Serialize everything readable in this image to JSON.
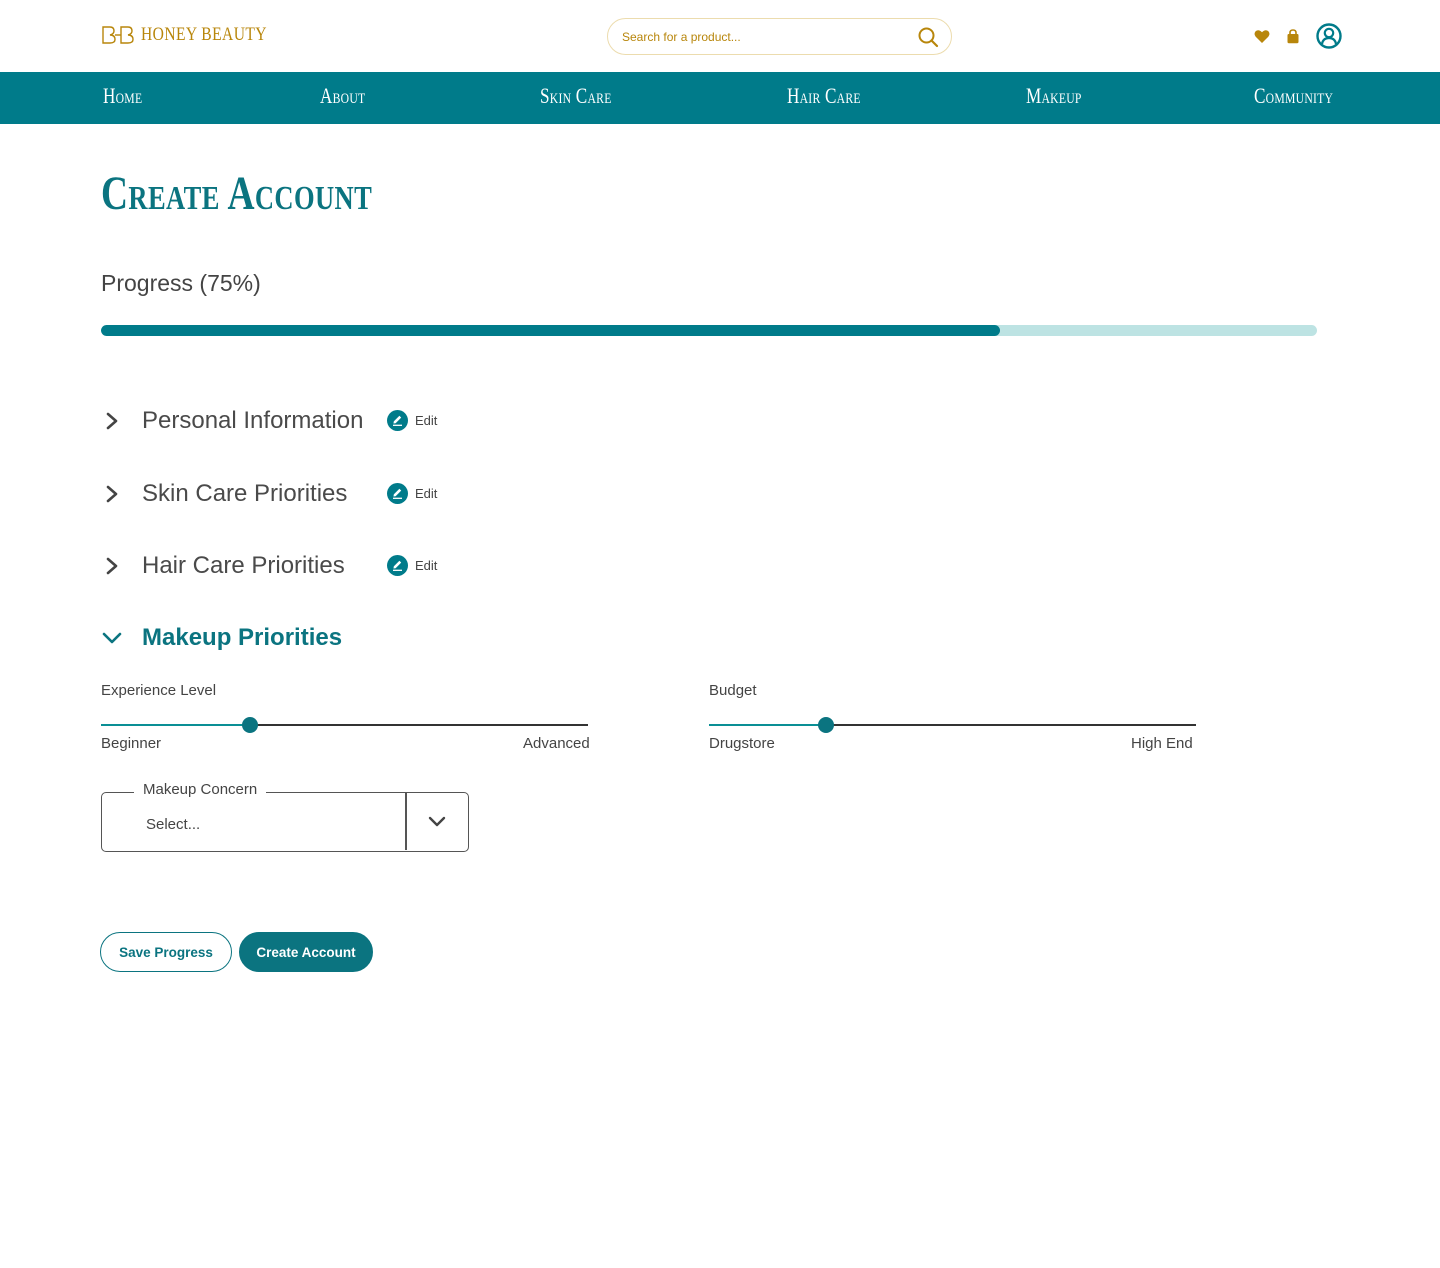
{
  "header": {
    "logo_text": "Honey Beauty",
    "search_placeholder": "Search for a product...",
    "icons": [
      "heart-icon",
      "bag-icon",
      "account-icon"
    ]
  },
  "nav": {
    "items": [
      {
        "label": "Home"
      },
      {
        "label": "About"
      },
      {
        "label": "Skin Care"
      },
      {
        "label": "Hair Care"
      },
      {
        "label": "Makeup"
      },
      {
        "label": "Community"
      }
    ]
  },
  "main": {
    "title": "Create Account",
    "progress_label": "Progress (75%)",
    "progress_value": 0.75,
    "sections": [
      {
        "title": "Personal Information",
        "edit_label": "Edit",
        "expanded": false
      },
      {
        "title": "Skin Care Priorities",
        "edit_label": "Edit",
        "expanded": false
      },
      {
        "title": "Hair Care Priorities",
        "edit_label": "Edit",
        "expanded": false
      },
      {
        "title": "Makeup Priorities",
        "expanded": true
      }
    ],
    "sliders": [
      {
        "label": "Experience Level",
        "min_label": "Beginner",
        "max_label": "Advanced",
        "value": 0.305
      },
      {
        "label": "Budget",
        "min_label": "Drugstore",
        "max_label": "High End",
        "value": 0.24
      }
    ],
    "makeup_concern": {
      "legend": "Makeup Concern",
      "value": "Select..."
    },
    "buttons": {
      "save": "Save Progress",
      "create": "Create Account"
    }
  },
  "colors": {
    "teal": "#007b8a",
    "gold": "#b8860b",
    "progress_track": "#bde3e3"
  }
}
